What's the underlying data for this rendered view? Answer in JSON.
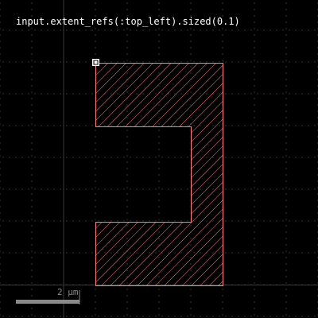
{
  "caption": "input.extent_refs(:top_left).sized(0.1)",
  "scale_bar": {
    "label": "2 µm"
  },
  "colors": {
    "background": "#000000",
    "grid_dot": "#6a6a6a",
    "axis_line": "#3a3a3a",
    "shape_stroke": "#ff8080",
    "hatch": "#ff8080",
    "marker": "#ffffff",
    "scale_bar": "#8a8a8a"
  },
  "icons": {
    "marker": "extent-reference-marker-icon"
  }
}
